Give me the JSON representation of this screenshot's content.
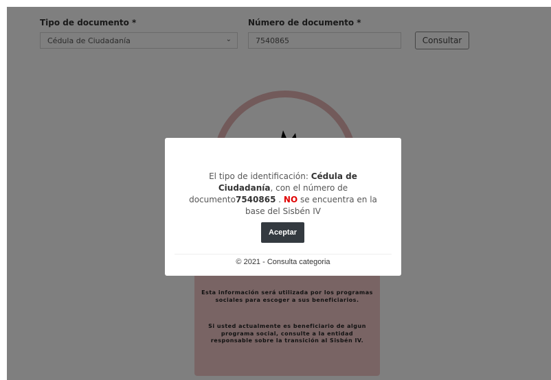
{
  "form": {
    "doc_type_label": "Tipo de documento *",
    "doc_type_value": "Cédula de Ciudadanía",
    "doc_number_label": "Número de documento *",
    "doc_number_value": "7540865",
    "consult_button": "Consultar"
  },
  "info_card": {
    "paragraph1": "Esta información será utilizada por los programas sociales para escoger a sus beneficiarios.",
    "paragraph2": "Si usted actualmente es beneficiario de algun programa social, consulte a la entidad responsable sobre la transición al Sisbén IV."
  },
  "modal": {
    "msg_prefix": "El tipo de identificación:",
    "msg_doc_type": "Cédula de Ciudadanía",
    "msg_mid": ", con el número de documento",
    "msg_doc_number": "7540865",
    "msg_dot": ".",
    "msg_no": "NO",
    "msg_suffix": "se encuentra en la base del Sisbén IV",
    "accept_button": "Aceptar",
    "footer": "© 2021 - Consulta categoria"
  },
  "colors": {
    "overlay": "rgba(0,0,0,0.5)",
    "card_bg": "#f2c9c9",
    "accent_no": "#e00000",
    "button_dark": "#343a40"
  }
}
